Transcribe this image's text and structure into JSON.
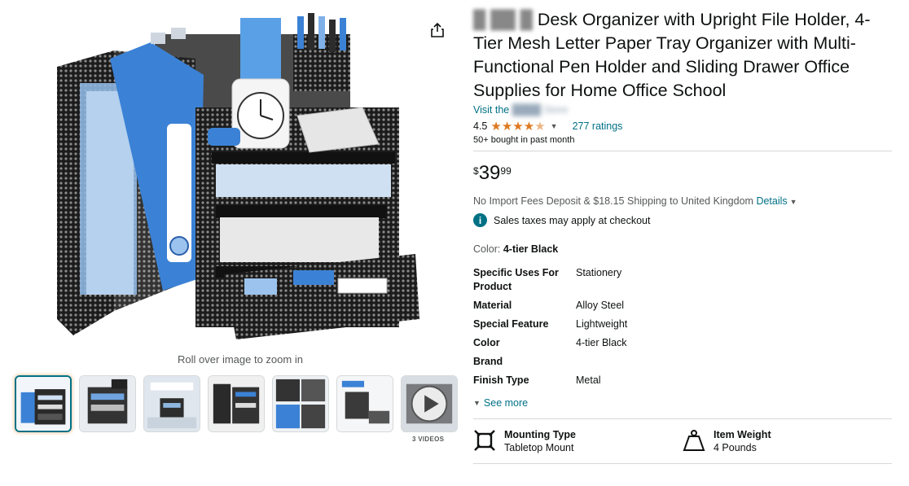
{
  "product": {
    "title_brand_redacted": "█ ██ █",
    "title_text": "Desk Organizer with Upright File Holder, 4-Tier Mesh Letter Paper Tray Organizer with Multi-Functional Pen Holder and Sliding Drawer Office Supplies for Home Office School",
    "store_link_prefix": "Visit the",
    "store_link_redacted": "████ Store",
    "rating_value": "4.5",
    "rating_count_label": "277 ratings",
    "bought_text": "50+ bought in past month"
  },
  "price": {
    "symbol": "$",
    "whole": "39",
    "fraction": "99"
  },
  "shipping": {
    "text": "No Import Fees Deposit & $18.15 Shipping to United Kingdom",
    "details_label": "Details",
    "tax_note": "Sales taxes may apply at checkout"
  },
  "color": {
    "label": "Color:",
    "value": "4-tier Black"
  },
  "specs": [
    {
      "key": "Specific Uses For Product",
      "value": "Stationery"
    },
    {
      "key": "Material",
      "value": "Alloy Steel"
    },
    {
      "key": "Special Feature",
      "value": "Lightweight"
    },
    {
      "key": "Color",
      "value": "4-tier Black"
    },
    {
      "key": "Brand",
      "value": ""
    },
    {
      "key": "Finish Type",
      "value": "Metal"
    }
  ],
  "see_more_label": "See more",
  "features": [
    {
      "icon": "mounting-icon",
      "label": "Mounting Type",
      "value": "Tabletop Mount"
    },
    {
      "icon": "weight-icon",
      "label": "Item Weight",
      "value": "4 Pounds"
    }
  ],
  "gallery": {
    "zoom_hint": "Roll over image to zoom in",
    "videos_label": "3 VIDEOS",
    "thumbnail_count": 7
  },
  "colors": {
    "link": "#007185",
    "star": "#de7921",
    "divider": "#d5d9d9"
  }
}
